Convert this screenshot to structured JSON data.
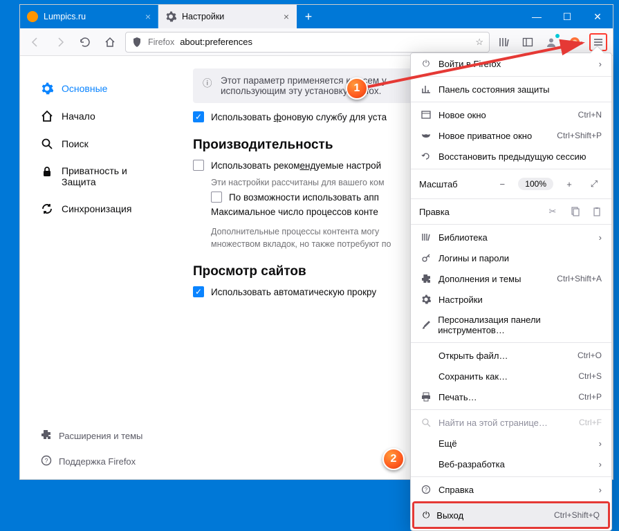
{
  "tabs": {
    "t1": "Lumpics.ru",
    "t2": "Настройки"
  },
  "navbar": {
    "brand": "Firefox",
    "url": "about:preferences"
  },
  "sidebar": {
    "general": "Основные",
    "home": "Начало",
    "search": "Поиск",
    "privacy_l1": "Приватность и",
    "privacy_l2": "Защита",
    "sync": "Синхронизация",
    "ext": "Расширения и темы",
    "support": "Поддержка Firefox"
  },
  "prefs": {
    "info_l1": "Этот параметр применяется ко всем у",
    "info_l2": "использующим эту установку Firefox.",
    "bg_service_pre": "Использовать ",
    "bg_service_u": "ф",
    "bg_service_post": "оновую службу для уста",
    "perf_h": "Производительность",
    "perf_reco_pre": "Использовать реком",
    "perf_reco_u": "енд",
    "perf_reco_post": "уемые настрой",
    "perf_sub": "Эти настройки рассчитаны для вашего ком",
    "perf_hw": "По возможности использовать апп",
    "perf_max": "Максимальное число процессов конте",
    "perf_note1": "Дополнительные процессы контента могу",
    "perf_note2": "множеством вкладок, но также потребуют по",
    "browsing_h": "Просмотр сайтов",
    "browsing_auto": "Использовать автоматическую прокру"
  },
  "menu": {
    "signin": "Войти в Firefox",
    "protections": "Панель состояния защиты",
    "newwin": "Новое окно",
    "newwin_s": "Ctrl+N",
    "newpriv": "Новое приватное окно",
    "newpriv_s": "Ctrl+Shift+P",
    "restore": "Восстановить предыдущую сессию",
    "zoom_lbl": "Масштаб",
    "zoom_val": "100%",
    "edit_lbl": "Правка",
    "library": "Библиотека",
    "logins": "Логины и пароли",
    "addons": "Дополнения и темы",
    "addons_s": "Ctrl+Shift+A",
    "settings": "Настройки",
    "customize": "Персонализация панели инструментов…",
    "open": "Открыть файл…",
    "open_s": "Ctrl+O",
    "save": "Сохранить как…",
    "save_s": "Ctrl+S",
    "print": "Печать…",
    "print_s": "Ctrl+P",
    "find": "Найти на этой странице…",
    "find_s": "Ctrl+F",
    "more": "Ещё",
    "webdev": "Веб-разработка",
    "help": "Справка",
    "exit": "Выход",
    "exit_s": "Ctrl+Shift+Q"
  },
  "badges": {
    "b1": "1",
    "b2": "2"
  }
}
